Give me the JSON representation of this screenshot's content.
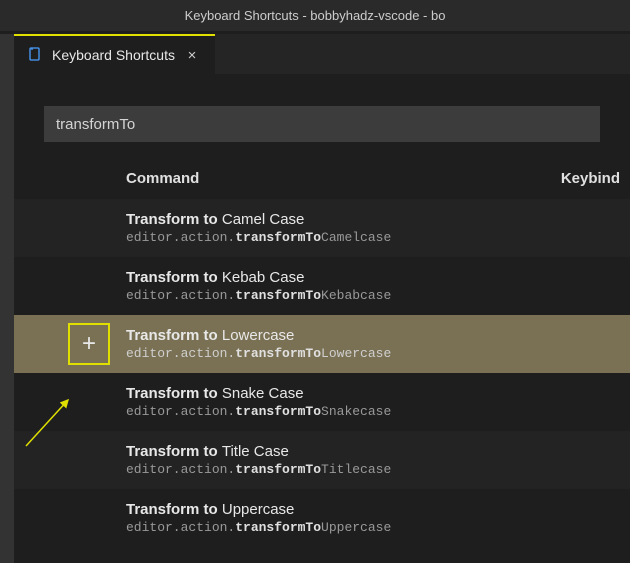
{
  "window": {
    "title": "Keyboard Shortcuts - bobbyhadz-vscode - bo"
  },
  "tab": {
    "label": "Keyboard Shortcuts"
  },
  "search": {
    "value": "transformTo"
  },
  "headers": {
    "command": "Command",
    "keybinding": "Keybind"
  },
  "rows": [
    {
      "label_prefix": "Transform to ",
      "label_suffix": "Camel Case",
      "id_prefix": "editor.action.",
      "id_bold": "transformTo",
      "id_suffix": "Camelcase",
      "selected": false
    },
    {
      "label_prefix": "Transform to ",
      "label_suffix": "Kebab Case",
      "id_prefix": "editor.action.",
      "id_bold": "transformTo",
      "id_suffix": "Kebabcase",
      "selected": false
    },
    {
      "label_prefix": "Transform to ",
      "label_suffix": "Lowercase",
      "id_prefix": "editor.action.",
      "id_bold": "transformTo",
      "id_suffix": "Lowercase",
      "selected": true
    },
    {
      "label_prefix": "Transform to ",
      "label_suffix": "Snake Case",
      "id_prefix": "editor.action.",
      "id_bold": "transformTo",
      "id_suffix": "Snakecase",
      "selected": false
    },
    {
      "label_prefix": "Transform to ",
      "label_suffix": "Title Case",
      "id_prefix": "editor.action.",
      "id_bold": "transformTo",
      "id_suffix": "Titlecase",
      "selected": false
    },
    {
      "label_prefix": "Transform to ",
      "label_suffix": "Uppercase",
      "id_prefix": "editor.action.",
      "id_bold": "transformTo",
      "id_suffix": "Uppercase",
      "selected": false
    }
  ],
  "icons": {
    "add": "+",
    "close": "×"
  },
  "colors": {
    "accent": "#e0e000",
    "selected_bg": "#7a7154"
  }
}
